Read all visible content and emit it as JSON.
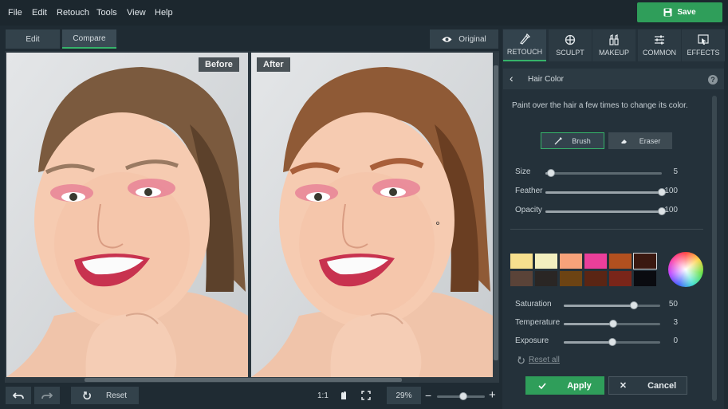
{
  "menu": [
    "File",
    "Edit",
    "Retouch",
    "Tools",
    "View",
    "Help"
  ],
  "save_label": "Save",
  "view_modes": {
    "edit": "Edit",
    "compare": "Compare"
  },
  "original_label": "Original",
  "labels": {
    "before": "Before",
    "after": "After"
  },
  "bottom": {
    "reset": "Reset",
    "ratio": "1:1",
    "zoom": "29%"
  },
  "tabs": [
    "RETOUCH",
    "SCULPT",
    "MAKEUP",
    "COMMON",
    "EFFECTS"
  ],
  "panel": {
    "title": "Hair Color",
    "help": "?",
    "instruction": "Paint over the hair a few times to change its color.",
    "brush": "Brush",
    "eraser": "Eraser",
    "sliders": [
      {
        "label": "Size",
        "value": "5",
        "pct": 0.05
      },
      {
        "label": "Feather",
        "value": "100",
        "pct": 1.0
      },
      {
        "label": "Opacity",
        "value": "100",
        "pct": 1.0
      }
    ],
    "color_sliders": [
      {
        "label": "Saturation",
        "value": "50",
        "pct": 0.73
      },
      {
        "label": "Temperature",
        "value": "3",
        "pct": 0.51
      },
      {
        "label": "Exposure",
        "value": "0",
        "pct": 0.5
      }
    ],
    "reset_all": "Reset all",
    "apply": "Apply",
    "cancel": "Cancel"
  },
  "swatches": [
    "#f7e08e",
    "#f3efbf",
    "#f6a27a",
    "#ea3f9a",
    "#b2501f",
    "#3a1810",
    "#5a4338",
    "#2a2624",
    "#6c4313",
    "#5a2514",
    "#7a2519",
    "#0a0b10"
  ],
  "colors": {
    "accent": "#36b36a",
    "save": "#2f9e5a"
  }
}
